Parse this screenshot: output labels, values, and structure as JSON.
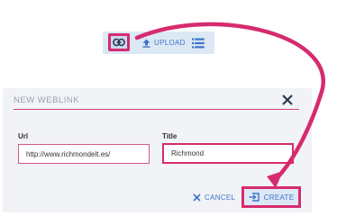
{
  "toolbar": {
    "link_icon": "link-icon",
    "upload_label": "UPLOAD",
    "upload_icon": "upload-arrow-icon",
    "list_icon": "list-icon"
  },
  "dialog": {
    "title": "NEW WEBLINK",
    "close_icon": "close-icon",
    "url_label": "Url",
    "url_value": "http://www.richmondelt.es/",
    "title_label": "Title",
    "title_value": "Richmond",
    "cancel_label": "CANCEL",
    "cancel_icon": "close-x-icon",
    "create_label": "CREATE",
    "create_icon": "create-link-icon"
  },
  "colors": {
    "accent_pink": "#d62b6e",
    "primary_blue": "#3b74c9",
    "toolbar_bg": "#dde8f5",
    "dialog_bg": "#f1f3f7"
  }
}
